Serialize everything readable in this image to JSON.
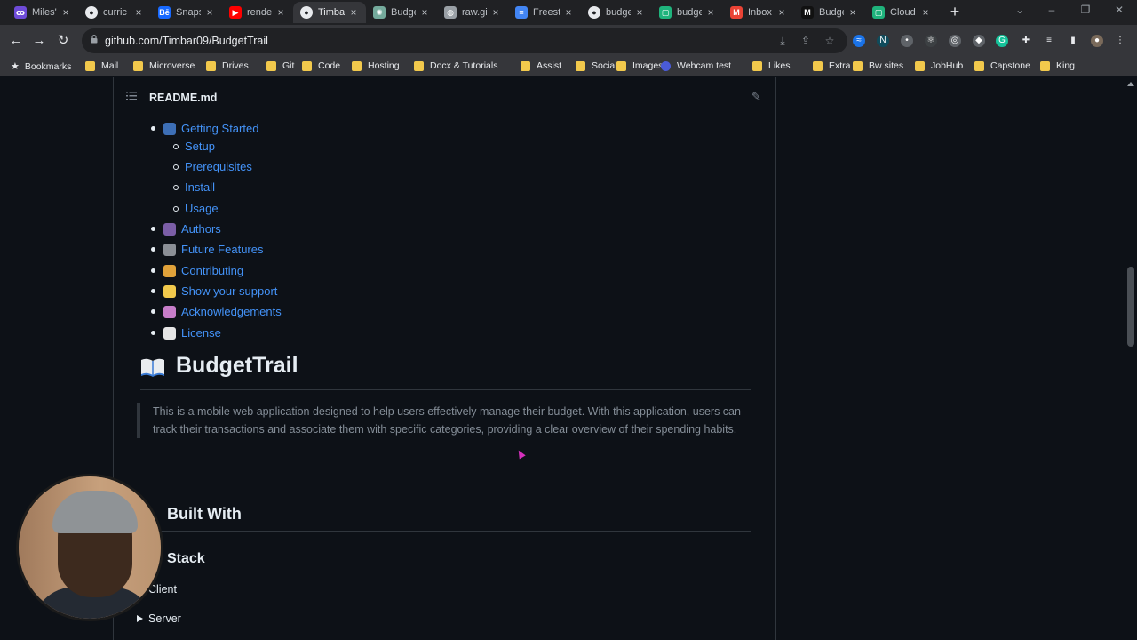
{
  "browser": {
    "tabs": [
      {
        "label": "Miles'",
        "icon": "miles-icon",
        "color": "#6e4bd8"
      },
      {
        "label": "curric",
        "icon": "github-icon",
        "color": "#e8eaed"
      },
      {
        "label": "Snaps",
        "icon": "behance-icon",
        "color": "#1769ff"
      },
      {
        "label": "render",
        "icon": "youtube-icon",
        "color": "#ff0000"
      },
      {
        "label": "Timba",
        "icon": "github-icon",
        "color": "#e8eaed",
        "active": true
      },
      {
        "label": "Budge",
        "icon": "chatgpt-icon",
        "color": "#74aa9c"
      },
      {
        "label": "raw.gi",
        "icon": "globe-icon",
        "color": "#9aa0a6"
      },
      {
        "label": "Freest",
        "icon": "docs-icon",
        "color": "#4285f4"
      },
      {
        "label": "budge",
        "icon": "github-icon",
        "color": "#e8eaed"
      },
      {
        "label": "budge",
        "icon": "render-icon",
        "color": "#1fb37c"
      },
      {
        "label": "Inbox",
        "icon": "gmail-icon",
        "color": "#ea4335"
      },
      {
        "label": "Budge",
        "icon": "medium-icon",
        "color": "#111111"
      },
      {
        "label": "Cloud",
        "icon": "render-icon",
        "color": "#1fb37c"
      }
    ],
    "url": "github.com/Timbar09/BudgetTrail",
    "bookmarks": [
      {
        "label": "Bookmarks",
        "kind": "star"
      },
      {
        "label": "Mail",
        "kind": "folder"
      },
      {
        "label": "Microverse",
        "kind": "folder"
      },
      {
        "label": "Drives",
        "kind": "folder"
      },
      {
        "label": "Git",
        "kind": "folder"
      },
      {
        "label": "Code",
        "kind": "folder"
      },
      {
        "label": "Hosting",
        "kind": "folder"
      },
      {
        "label": "Docx & Tutorials",
        "kind": "folder"
      },
      {
        "label": "Assist",
        "kind": "folder"
      },
      {
        "label": "Socials",
        "kind": "folder"
      },
      {
        "label": "Images",
        "kind": "folder"
      },
      {
        "label": "Webcam test",
        "kind": "page"
      },
      {
        "label": "Likes",
        "kind": "folder"
      },
      {
        "label": "Extra",
        "kind": "folder"
      },
      {
        "label": "Bw sites",
        "kind": "folder"
      },
      {
        "label": "JobHub",
        "kind": "folder"
      },
      {
        "label": "Capstone",
        "kind": "folder"
      },
      {
        "label": "King",
        "kind": "folder"
      }
    ]
  },
  "readme": {
    "filename": "README.md",
    "toc": [
      {
        "label": "Getting Started",
        "emoji": "laptop-icon",
        "level": 1
      },
      {
        "label": "Setup",
        "level": 2
      },
      {
        "label": "Prerequisites",
        "level": 2
      },
      {
        "label": "Install",
        "level": 2
      },
      {
        "label": "Usage",
        "level": 2
      },
      {
        "label": "Authors",
        "emoji": "people-icon",
        "level": 1
      },
      {
        "label": "Future Features",
        "emoji": "telescope-icon",
        "level": 1
      },
      {
        "label": "Contributing",
        "emoji": "handshake-icon",
        "level": 1
      },
      {
        "label": "Show your support",
        "emoji": "star-icon",
        "level": 1
      },
      {
        "label": "Acknowledgements",
        "emoji": "pray-icon",
        "level": 1
      },
      {
        "label": "License",
        "emoji": "memo-icon",
        "level": 1
      }
    ],
    "title": "BudgetTrail",
    "description": "This is a mobile web application designed to help users effectively manage their budget. With this application, users can track their transactions and associate them with specific categories, providing a clear overview of their spending habits.",
    "built_with": "Built With",
    "tech_stack": "Stack",
    "details": [
      "Client",
      "Server"
    ]
  },
  "colors": {
    "link": "#4493f8",
    "text": "#e6edf3",
    "muted": "#848d97",
    "bg": "#0d1117",
    "border": "#30363d"
  }
}
